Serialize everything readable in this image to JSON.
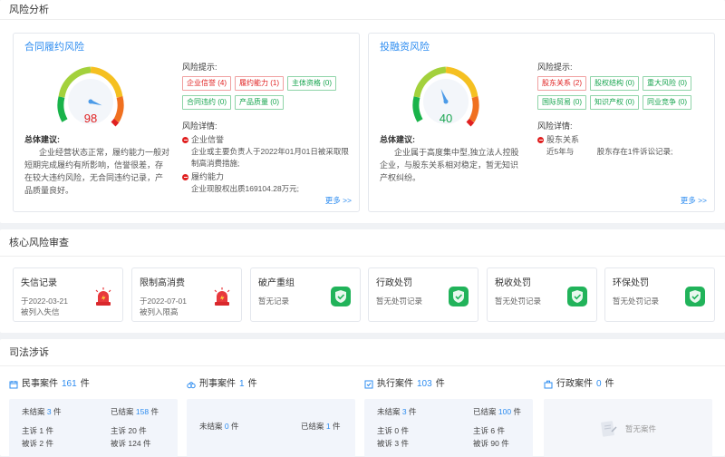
{
  "risk": {
    "title": "风险分析",
    "cards": [
      {
        "title": "合同履约风险",
        "score": "98",
        "score_value": 98,
        "score_color": "#e02020",
        "tips_label": "风险提示:",
        "tags": [
          {
            "text": "企业信誉 (4)",
            "level": "red"
          },
          {
            "text": "履约能力 (1)",
            "level": "red"
          },
          {
            "text": "主体资格 (0)",
            "level": "green"
          },
          {
            "text": "合同违约 (0)",
            "level": "green"
          },
          {
            "text": "产品质量 (0)",
            "level": "green"
          }
        ],
        "summary_title": "总体建议:",
        "summary_body": "企业经营状态正常，履约能力一般对短期完成履约有所影响，信誉很差，存在较大违约风险，无合同违约记录，产品质量良好。",
        "details_label": "风险详情:",
        "details": [
          {
            "name": "企业信誉",
            "desc": "企业或主要负责人于2022年01月01日被采取限制高消费措施;"
          },
          {
            "name": "履约能力",
            "desc": "企业现股权出质169104.28万元;"
          }
        ],
        "more": "更多 >>"
      },
      {
        "title": "投融资风险",
        "score": "40",
        "score_value": 40,
        "score_color": "#19a550",
        "tips_label": "风险提示:",
        "tags": [
          {
            "text": "股东关系 (2)",
            "level": "red"
          },
          {
            "text": "股权结构 (0)",
            "level": "green"
          },
          {
            "text": "重大风险 (0)",
            "level": "green"
          },
          {
            "text": "国际贸易 (0)",
            "level": "green"
          },
          {
            "text": "知识产权 (0)",
            "level": "green"
          },
          {
            "text": "同业竞争 (0)",
            "level": "green"
          }
        ],
        "summary_title": "总体建议:",
        "summary_body": "企业属于高度集中型,独立法人控股企业，与股东关系相对稳定，暂无知识产权纠纷。",
        "details_label": "风险详情:",
        "details": [
          {
            "name": "股东关系",
            "desc": "近5年与　　　股东存在1件诉讼记录;"
          }
        ],
        "more": "更多 >>"
      }
    ]
  },
  "core": {
    "title": "核心风险审查",
    "cards": [
      {
        "title": "失信记录",
        "desc1": "于2022-03-21",
        "desc2": "被列入失信",
        "icon": "alarm-icon"
      },
      {
        "title": "限制高消费",
        "desc1": "于2022-07-01",
        "desc2": "被列入限高",
        "icon": "alarm-icon"
      },
      {
        "title": "破产重组",
        "desc1": "暂无记录",
        "desc2": "",
        "icon": "shield-check-icon"
      },
      {
        "title": "行政处罚",
        "desc1": "暂无处罚记录",
        "desc2": "",
        "icon": "shield-check-icon"
      },
      {
        "title": "税收处罚",
        "desc1": "暂无处罚记录",
        "desc2": "",
        "icon": "shield-check-icon"
      },
      {
        "title": "环保处罚",
        "desc1": "暂无处罚记录",
        "desc2": "",
        "icon": "shield-check-icon"
      }
    ]
  },
  "judicial": {
    "title": "司法涉诉",
    "unit": "件",
    "cols": [
      {
        "name": "民事案件",
        "count": "161",
        "icon": "calendar-icon",
        "pending_label": "未结案",
        "pending": "3",
        "closed_label": "已结案",
        "closed": "158",
        "plaintiff_label": "主诉",
        "p1": "1",
        "p2": "20",
        "defendant_label": "被诉",
        "d1": "2",
        "d2": "124"
      },
      {
        "name": "刑事案件",
        "count": "1",
        "icon": "handcuff-icon",
        "pending_label": "未结案",
        "pending": "0",
        "closed_label": "已结案",
        "closed": "1"
      },
      {
        "name": "执行案件",
        "count": "103",
        "icon": "check-square-icon",
        "pending_label": "未结案",
        "pending": "3",
        "closed_label": "已结案",
        "closed": "100",
        "plaintiff_label": "主诉",
        "p1": "0",
        "p2": "6",
        "defendant_label": "被诉",
        "d1": "3",
        "d2": "90"
      },
      {
        "name": "行政案件",
        "count": "0",
        "icon": "briefcase-icon",
        "empty": "暂无案件"
      }
    ]
  }
}
